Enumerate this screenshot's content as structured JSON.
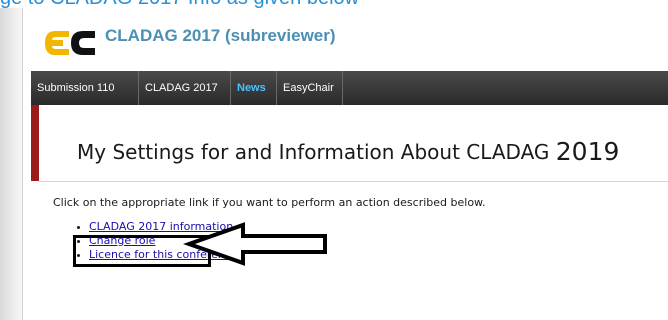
{
  "top_fragment": "ge to CLADAG 2017 Info as given below",
  "header": {
    "logo_icon": "easychair-logo-icon",
    "app_title": "CLADAG 2017 (subreviewer)"
  },
  "menu": {
    "items": [
      {
        "label": "Submission 110",
        "active": false
      },
      {
        "label": "CLADAG 2017",
        "active": false
      },
      {
        "label": "News",
        "active": true
      },
      {
        "label": "EasyChair",
        "active": false
      }
    ]
  },
  "page": {
    "title": "My Settings for and Information About CLADAG",
    "title_year": "2019",
    "instruction": "Click on the appropriate link if you want to perform an action described below.",
    "links": [
      {
        "label": "CLADAG 2017 information"
      },
      {
        "label": "Change role"
      },
      {
        "label": "Licence for this conference"
      }
    ]
  },
  "annotation": {
    "arrow_icon": "left-arrow-icon",
    "highlight_target": "Change role"
  },
  "colors": {
    "menu_bg": "#333333",
    "menu_active": "#4cc3ff",
    "link": "#1a0dab",
    "accent_bar": "#9b1b1b",
    "app_title": "#4c8fb5"
  }
}
